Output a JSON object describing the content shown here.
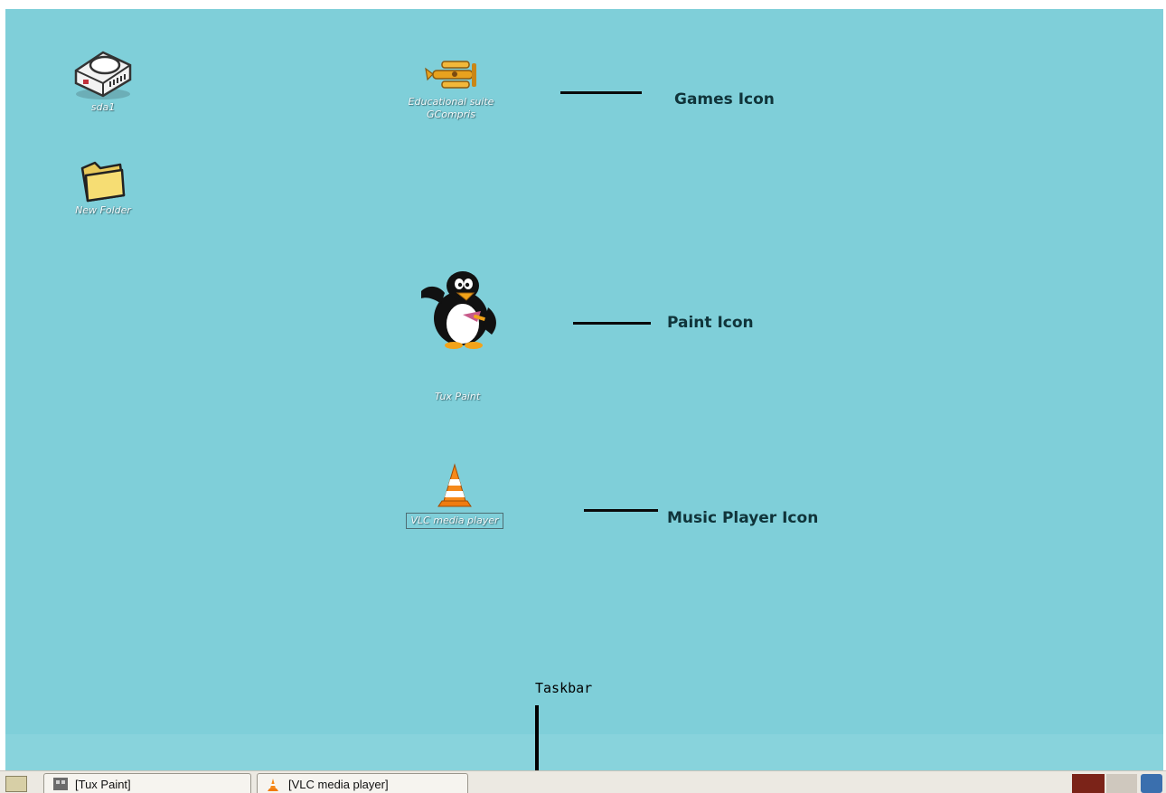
{
  "desktop": {
    "icons": [
      {
        "id": "sda1",
        "label_lines": [
          "sda1"
        ]
      },
      {
        "id": "new-folder",
        "label_lines": [
          "New Folder"
        ]
      },
      {
        "id": "educational-suite",
        "label_lines": [
          "Educational suite",
          "GCompris"
        ]
      },
      {
        "id": "tux-paint",
        "label_lines": [
          "Tux Paint"
        ]
      },
      {
        "id": "vlc",
        "label_lines": [
          "VLC media player"
        ],
        "selected": true
      }
    ]
  },
  "annotations": {
    "games": "Games Icon",
    "paint": "Paint Icon",
    "music": "Music Player Icon",
    "taskbar": "Taskbar"
  },
  "taskbar": {
    "tasks": [
      {
        "label": "[Tux Paint]",
        "icon": "tux-paint-icon"
      },
      {
        "label": "[VLC media player]",
        "icon": "vlc-cone-icon"
      }
    ]
  },
  "colors": {
    "desktop_bg": "#7fcfd9",
    "taskbar_bg": "#ece9e2",
    "annotation_text": "#10343a"
  }
}
